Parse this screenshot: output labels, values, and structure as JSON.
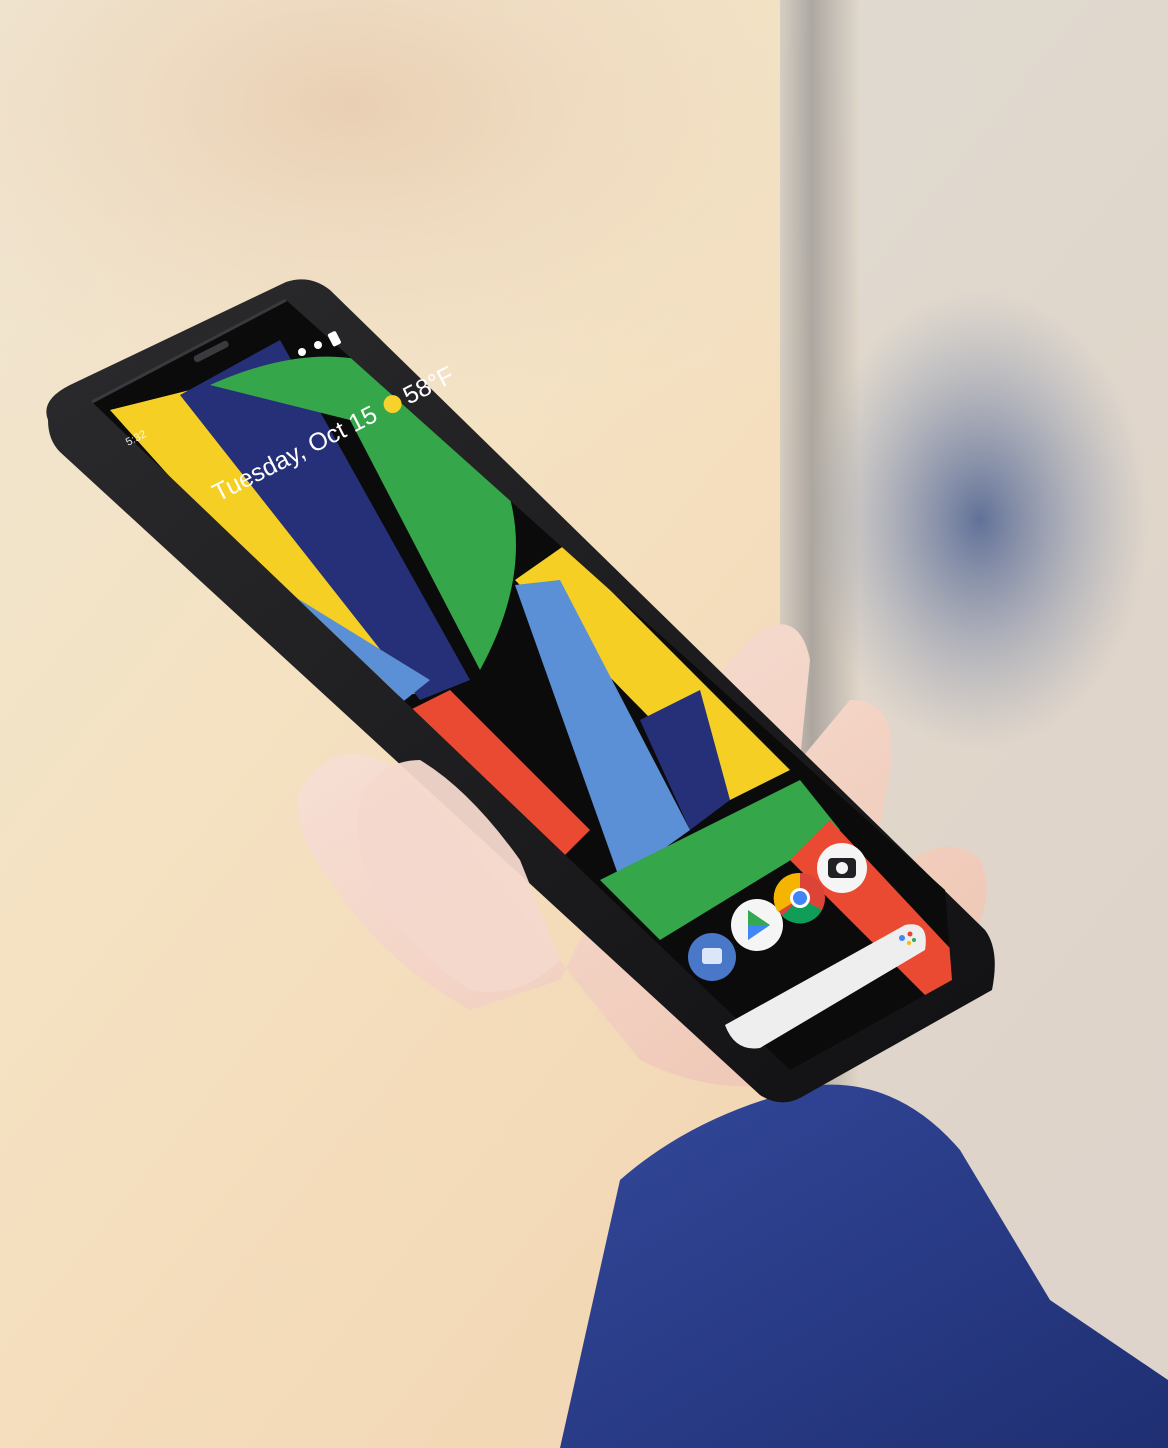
{
  "photo": {
    "background_colors": {
      "cream": "#f5e9cf",
      "peach": "#f0c9a2",
      "grey": "#9fa4ad",
      "blue_blur": "#5a6e96"
    },
    "sleeve_color": "#2a3f8a",
    "skin_color": "#f2d2c2"
  },
  "phone": {
    "frame_color": "#1b1b1d",
    "status_bar": {
      "time_label": "5:32"
    },
    "at_a_glance": {
      "date": "Tuesday, Oct 15",
      "weather_icon": "sun-icon",
      "temperature": "58°F"
    },
    "wallpaper_colors": {
      "yellow": "#f6cf25",
      "navy": "#253078",
      "green": "#35a64a",
      "light_blue": "#5b8fd6",
      "red": "#eb4a32",
      "black": "#0b0b0c"
    },
    "dock_apps": [
      {
        "name": "messages",
        "icon": "messages-icon"
      },
      {
        "name": "play-store",
        "icon": "play-store-icon"
      },
      {
        "name": "chrome",
        "icon": "chrome-icon"
      },
      {
        "name": "camera",
        "icon": "camera-icon"
      }
    ],
    "search_bar": {
      "icon": "google-assistant-icon"
    }
  }
}
